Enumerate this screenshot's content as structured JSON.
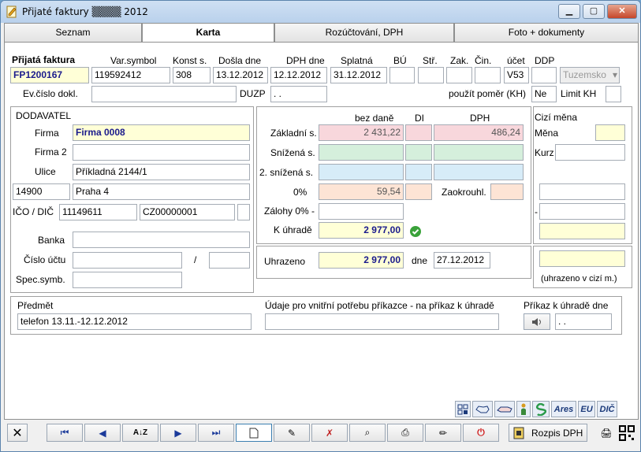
{
  "window": {
    "title": "Přijaté faktury ▒▒▒▒ 2012",
    "min": "▁",
    "max": "▢",
    "close": "✕"
  },
  "tabs": [
    {
      "label": "Seznam"
    },
    {
      "label": "Karta"
    },
    {
      "label": "Rozúčtování, DPH"
    },
    {
      "label": "Foto + dokumenty"
    }
  ],
  "header": {
    "invoice_label": "Přijatá faktura",
    "invoice_no": "FP1200167",
    "var_symbol_label": "Var.symbol",
    "var_symbol": "119592412",
    "konst_label": "Konst s.",
    "konst": "308",
    "dosla_label": "Došla dne",
    "dosla": "13.12.2012",
    "dph_dne_label": "DPH dne",
    "dph_dne": "12.12.2012",
    "splatna_label": "Splatná",
    "splatna": "31.12.2012",
    "bu_label": "BÚ",
    "str_label": "Stř.",
    "zak_label": "Zak.",
    "cin_label": "Čin.",
    "ucet_label": "účet",
    "ucet": "V53",
    "ddp_label": "DDP",
    "tuzemsko": "Tuzemsko",
    "evc_label": "Ev.číslo dokl.",
    "duzp_label": "DUZP",
    "duzp": " .  .",
    "pomer_label": "použít poměr (KH)",
    "pomer": "Ne",
    "limit_label": "Limit KH"
  },
  "supplier": {
    "title": "DODAVATEL",
    "firma_label": "Firma",
    "firma": "Firma 0008",
    "firma2_label": "Firma 2",
    "firma2": "",
    "ulice_label": "Ulice",
    "ulice": "Příkladná 2144/1",
    "psc": "14900",
    "mesto": "Praha 4",
    "ico_label": "IČO / DIČ",
    "ico": "11149611",
    "dic": "CZ00000001",
    "banka_label": "Banka",
    "ucet_label": "Číslo účtu",
    "slash": "/",
    "spec_label": "Spec.symb."
  },
  "vat": {
    "bez_dane": "bez daně",
    "di": "DI",
    "dph": "DPH",
    "zakladni_label": "Základní s.",
    "zakladni_base": "2 431,22",
    "zakladni_dph": "486,24",
    "snizena_label": "Snížená s.",
    "snizena2_label": "2. snížená s.",
    "zero_label": "0%",
    "zero_base": "59,54",
    "zaokr_label": "Zaokrouhl.",
    "zalohy_label": "Zálohy 0% -",
    "k_uhrade_label": "K úhradě",
    "k_uhrade": "2 977,00",
    "uhrazeno_label": "Uhrazeno",
    "uhrazeno": "2 977,00",
    "dne_label": "dne",
    "dne": "27.12.2012"
  },
  "foreign": {
    "title": "Cizí měna",
    "mena_label": "Měna",
    "kurz_label": "Kurz",
    "dash": "-",
    "note": "(uhrazeno v cizí m.)"
  },
  "bottom": {
    "predmet_label": "Předmět",
    "predmet": "telefon 13.11.-12.12.2012",
    "udaje_label": "Údaje pro vnitřní potřebu příkazce - na příkaz k úhradě",
    "prikaz_label": "Příkaz k úhradě dne",
    "prikaz_date": " .  ."
  },
  "icons": {
    "ares": "Ares",
    "eu": "EU",
    "dic": "DIČ"
  },
  "toolbar": {
    "rozpis": "Rozpis DPH"
  }
}
